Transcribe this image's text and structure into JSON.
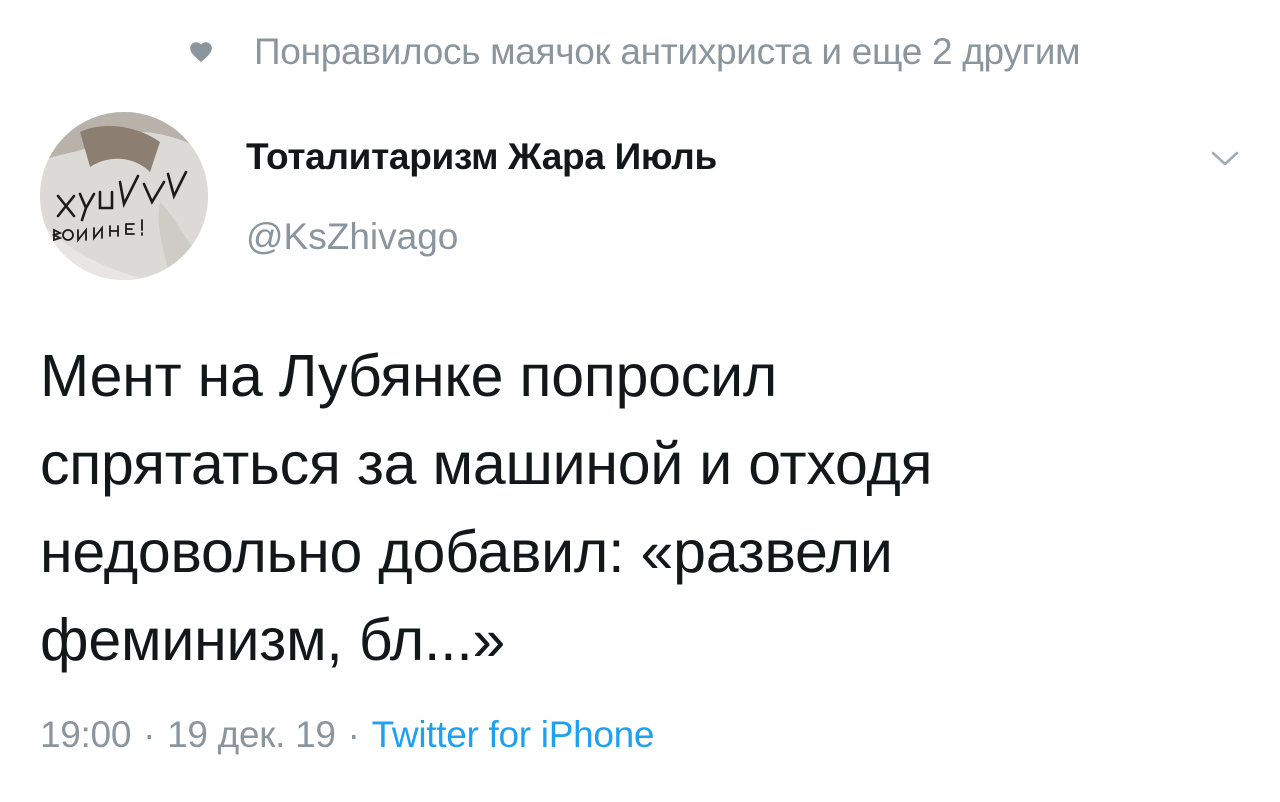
{
  "liked_by": {
    "icon": "heart-icon",
    "text": "Понравилось маячок антихриста и еще 2 другим"
  },
  "author": {
    "avatar_text_top": "ХУЙ",
    "avatar_text_bottom": "ВОЙНЕ!",
    "display_name": "Тоталитаризм Жара Июль",
    "handle": "@KsZhivago",
    "menu_icon": "chevron-down-icon"
  },
  "tweet": {
    "lines": [
      "Мент на Лубянке попросил",
      "спрятаться за машиной и отходя",
      "недовольно добавил: «развели",
      "феминизм, бл...»"
    ]
  },
  "meta": {
    "time": "19:00",
    "separator": "·",
    "date": "19 дек. 19",
    "source": "Twitter for iPhone"
  },
  "colors": {
    "text": "#14171a",
    "secondary": "#8a959e",
    "link": "#1da1f2"
  }
}
